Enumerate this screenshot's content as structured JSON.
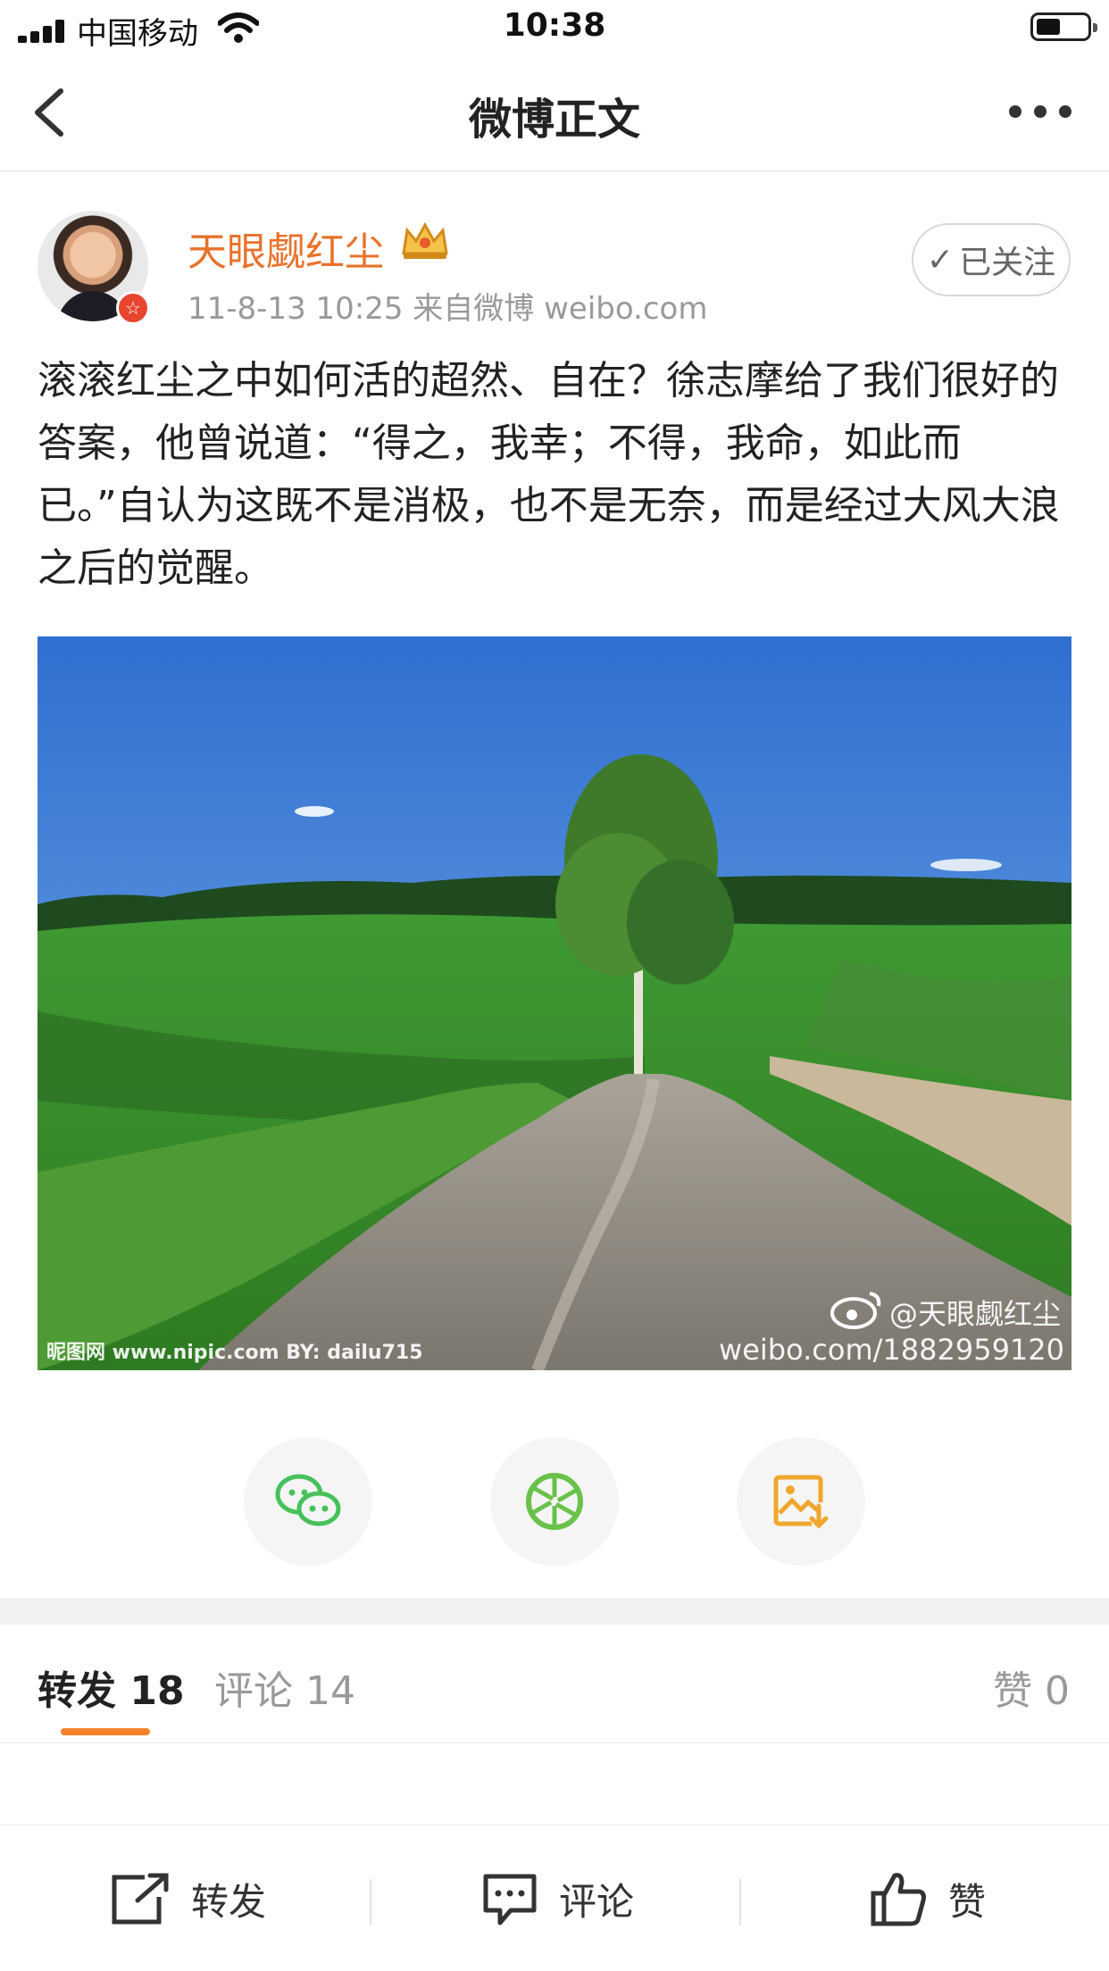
{
  "status_bar": {
    "carrier": "中国移动",
    "time": "10:38"
  },
  "nav": {
    "title": "微博正文"
  },
  "post": {
    "username": "天眼觑红尘",
    "meta": "11-8-13 10:25  来自微博 weibo.com",
    "follow_label": "已关注",
    "text": "滚滚红尘之中如何活的超然、自在？徐志摩给了我们很好的答案，他曾说道：“得之，我幸；不得，我命，如此而已。”自认为这既不是消极，也不是无奈，而是经过大风大浪之后的觉醒。",
    "image_watermark_handle": "@天眼觑红尘",
    "image_watermark_url": "weibo.com/1882959120",
    "image_watermark_site": "昵图网 www.nipic.com  BY: dailu715"
  },
  "tabs": {
    "repost": {
      "label": "转发",
      "count": "18"
    },
    "comment": {
      "label": "评论",
      "count": "14"
    },
    "like": {
      "label": "赞",
      "count": "0"
    }
  },
  "toolbar": {
    "repost": "转发",
    "comment": "评论",
    "like": "赞"
  },
  "colors": {
    "accent": "#f5822a",
    "username": "#e8722b",
    "wechat": "#47c15a",
    "moments": "#69c24a",
    "save": "#f0a62d"
  }
}
